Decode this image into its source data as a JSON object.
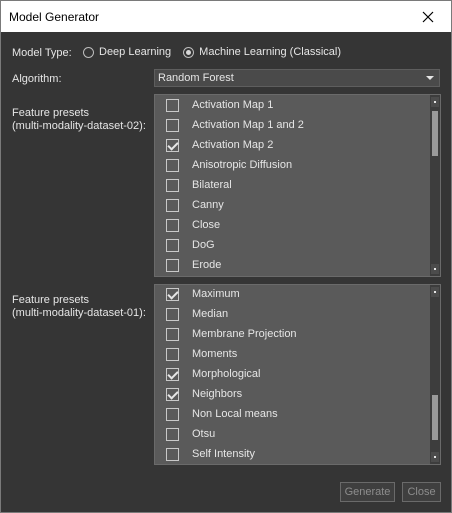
{
  "window": {
    "title": "Model Generator"
  },
  "model_type": {
    "label": "Model Type:",
    "options": [
      {
        "label": "Deep Learning",
        "checked": false
      },
      {
        "label": "Machine Learning (Classical)",
        "checked": true
      }
    ]
  },
  "algorithm": {
    "label": "Algorithm:",
    "value": "Random Forest"
  },
  "presets_02": {
    "label_line1": "Feature presets",
    "label_line2": "(multi-modality-dataset-02):",
    "items": [
      {
        "label": "Activation Map 1",
        "checked": false
      },
      {
        "label": "Activation Map 1 and 2",
        "checked": false
      },
      {
        "label": "Activation Map 2",
        "checked": true
      },
      {
        "label": "Anisotropic Diffusion",
        "checked": false
      },
      {
        "label": "Bilateral",
        "checked": false
      },
      {
        "label": "Canny",
        "checked": false
      },
      {
        "label": "Close",
        "checked": false
      },
      {
        "label": "DoG",
        "checked": false
      },
      {
        "label": "Erode",
        "checked": false
      }
    ]
  },
  "presets_01": {
    "label_line1": "Feature presets",
    "label_line2": "(multi-modality-dataset-01):",
    "items": [
      {
        "label": "Maximum",
        "checked": true
      },
      {
        "label": "Median",
        "checked": false
      },
      {
        "label": "Membrane Projection",
        "checked": false
      },
      {
        "label": "Moments",
        "checked": false
      },
      {
        "label": "Morphological",
        "checked": true
      },
      {
        "label": "Neighbors",
        "checked": true
      },
      {
        "label": "Non Local means",
        "checked": false
      },
      {
        "label": "Otsu",
        "checked": false
      },
      {
        "label": "Self Intensity",
        "checked": false
      }
    ]
  },
  "buttons": {
    "generate": "Generate",
    "close": "Close"
  }
}
